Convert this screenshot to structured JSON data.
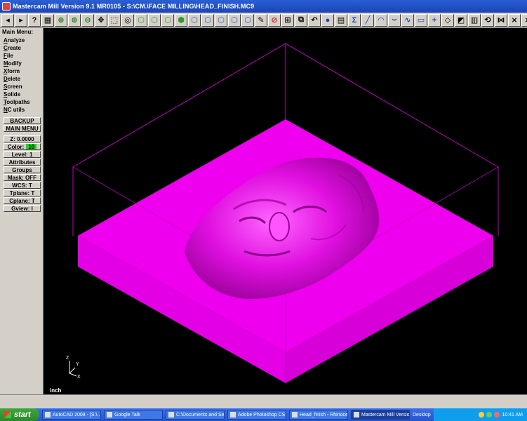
{
  "window": {
    "title": "Mastercam Mill Version 9.1 MR0105 - S:\\CM.\\FACE MILLING\\HEAD_FINISH.MC9"
  },
  "toolbar": {
    "buttons": [
      "back-arrow",
      "forward-arrow",
      "help",
      "calculator",
      "zoom-region",
      "zoom-in",
      "zoom-out",
      "pan",
      "select",
      "fit",
      "gview-top",
      "gview-front",
      "gview-side",
      "gview-iso",
      "cube-1",
      "cube-2",
      "cube-3",
      "cube-4",
      "cube-5",
      "pencil",
      "no-entry",
      "measure",
      "transform",
      "undo",
      "shade",
      "level",
      "sigma",
      "line",
      "arc",
      "curve",
      "spline",
      "rectangle",
      "plus",
      "surface",
      "chamfer",
      "drill",
      "rotate",
      "mirror",
      "trim",
      "more"
    ]
  },
  "menu": {
    "header": "Main Menu:",
    "items": [
      {
        "u": "A",
        "rest": "nalyze"
      },
      {
        "u": "C",
        "rest": "reate"
      },
      {
        "u": "F",
        "rest": "ile"
      },
      {
        "u": "M",
        "rest": "odify"
      },
      {
        "u": "X",
        "rest": "form"
      },
      {
        "u": "D",
        "rest": "elete"
      },
      {
        "u": "S",
        "rest": "creen"
      },
      {
        "u": "S",
        "rest": "olids"
      },
      {
        "u": "T",
        "rest": "oolpaths"
      },
      {
        "u": "N",
        "rest": "C utils"
      }
    ],
    "backup": "BACKUP",
    "main_menu": "MAIN MENU",
    "z_label": "Z:",
    "z_value": "0.0000",
    "color_label": "Color:",
    "color_value": "10",
    "level_label": "Level:",
    "level_value": "1",
    "attributes": "Attributes",
    "groups": "Groups",
    "mask_label": "Mask:",
    "mask_value": "OFF",
    "wcs_label": "WCS:",
    "wcs_value": "T",
    "tplane_label": "Tplane:",
    "tplane_value": "T",
    "cplane_label": "Cplane:",
    "cplane_value": "T",
    "gview_label": "Gview:",
    "gview_value": "I"
  },
  "viewport": {
    "unit": "inch",
    "axis_x": "X",
    "axis_y": "Y",
    "axis_z": "Z",
    "model_color": "#ee00ee",
    "model_dark": "#b000b0",
    "wire_color": "#c000c0"
  },
  "taskbar": {
    "start": "start",
    "tasks": [
      {
        "label": "AutoCAD 2008 - [S:\\...",
        "active": false
      },
      {
        "label": "Google Talk",
        "active": false
      },
      {
        "label": "C:\\Documents and Se...",
        "active": false
      },
      {
        "label": "Adobe Photoshop CS...",
        "active": false
      },
      {
        "label": "Head_finish - Rhinoce...",
        "active": false
      },
      {
        "label": "Mastercam Mill Versio...",
        "active": true
      }
    ],
    "desktop": "Desktop",
    "clock": "10:41 AM"
  }
}
